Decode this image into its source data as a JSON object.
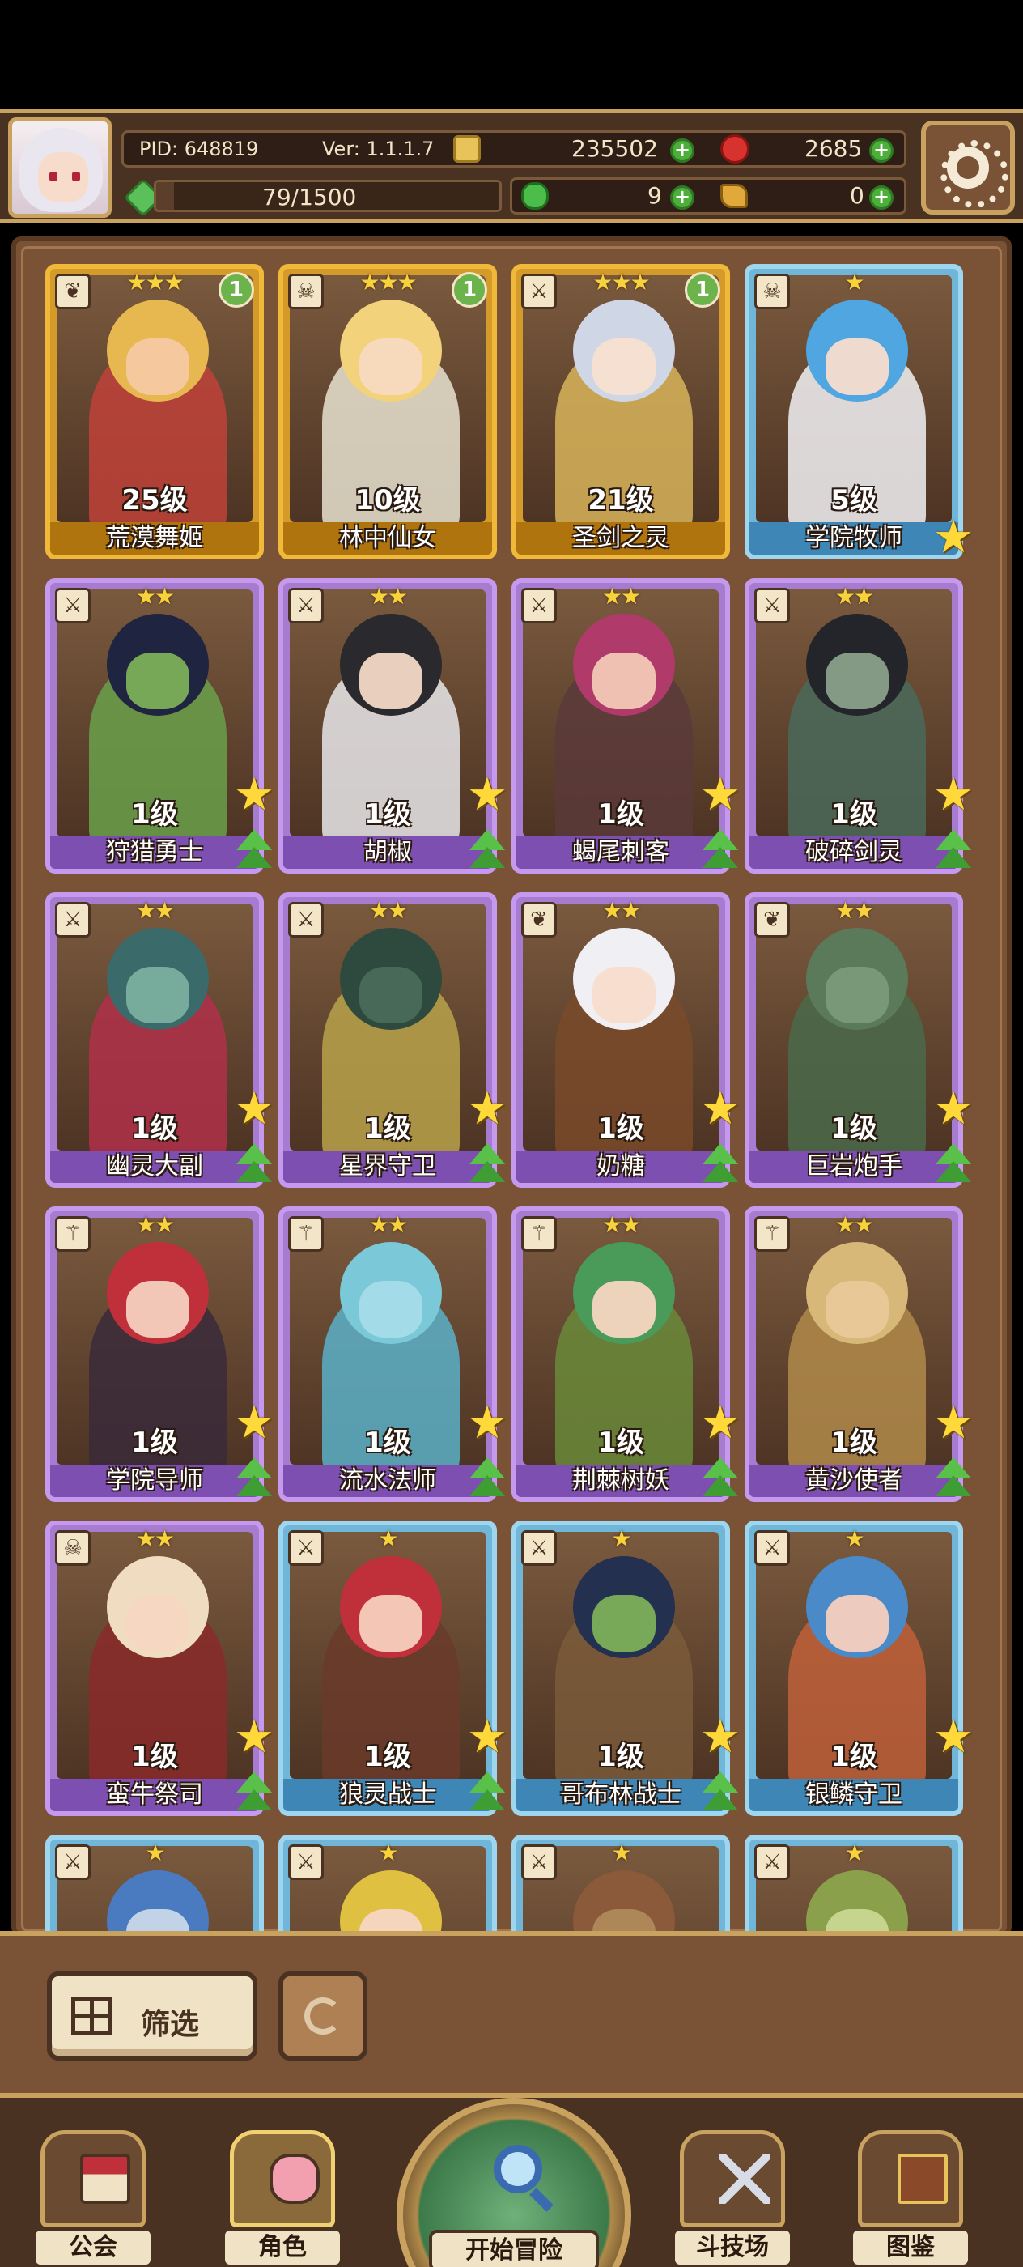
{
  "header": {
    "pid": "PID: 648819",
    "version": "Ver: 1.1.1.7",
    "gold": "235502",
    "rubies": "2685",
    "energy": "79/1500",
    "energy_value": 79,
    "energy_max": 1500,
    "clover": "9",
    "scrolls": "0"
  },
  "heroes": [
    {
      "name": "荒漠舞姬",
      "level": "25级",
      "rarity": "gold",
      "stars": "★★★",
      "badge": "1",
      "class_icon": "leaf",
      "palette": [
        "#e8b850",
        "#c0423a",
        "#f5c8a2"
      ]
    },
    {
      "name": "林中仙女",
      "level": "10级",
      "rarity": "gold",
      "stars": "★★★",
      "badge": "1",
      "class_icon": "skull",
      "palette": [
        "#f2d27a",
        "#e7e3d0",
        "#f7d9c0"
      ]
    },
    {
      "name": "圣剑之灵",
      "level": "21级",
      "rarity": "gold",
      "stars": "★★★",
      "badge": "1",
      "class_icon": "sword",
      "palette": [
        "#cfd6e6",
        "#d8b45a",
        "#f7e0d0"
      ]
    },
    {
      "name": "学院牧师",
      "level": "5级",
      "rarity": "blue",
      "stars": "★",
      "badge": "",
      "class_icon": "skull",
      "palette": [
        "#4fa6e0",
        "#f2f2f4",
        "#f7dccc"
      ]
    },
    {
      "name": "狩猎勇士",
      "level": "1级",
      "rarity": "purple",
      "stars": "★★",
      "badge": "",
      "class_icon": "sword",
      "palette": [
        "#1f2440",
        "#6aa04a",
        "#7cb05a"
      ]
    },
    {
      "name": "胡椒",
      "level": "1级",
      "rarity": "purple",
      "stars": "★★",
      "badge": "",
      "class_icon": "sword",
      "palette": [
        "#2a2a2e",
        "#e8e8ea",
        "#f2d8c6"
      ]
    },
    {
      "name": "蝎尾刺客",
      "level": "1级",
      "rarity": "purple",
      "stars": "★★",
      "badge": "",
      "class_icon": "sword",
      "palette": [
        "#b03a6a",
        "#5a3a3a",
        "#f2c8b6"
      ]
    },
    {
      "name": "破碎剑灵",
      "level": "1级",
      "rarity": "purple",
      "stars": "★★",
      "badge": "",
      "class_icon": "sword",
      "palette": [
        "#24252a",
        "#4a6a5a",
        "#8aa08a"
      ]
    },
    {
      "name": "幽灵大副",
      "level": "1级",
      "rarity": "purple",
      "stars": "★★",
      "badge": "",
      "class_icon": "sword",
      "palette": [
        "#3a6a6a",
        "#b0304a",
        "#7ab0a0"
      ]
    },
    {
      "name": "星界守卫",
      "level": "1级",
      "rarity": "purple",
      "stars": "★★",
      "badge": "",
      "class_icon": "sword",
      "palette": [
        "#2e4a3e",
        "#b8a24a",
        "#4a6a5a"
      ]
    },
    {
      "name": "奶糖",
      "level": "1级",
      "rarity": "purple",
      "stars": "★★",
      "badge": "",
      "class_icon": "leaf",
      "palette": [
        "#f0f0f4",
        "#7a4a2a",
        "#f7dccc"
      ]
    },
    {
      "name": "巨岩炮手",
      "level": "1级",
      "rarity": "purple",
      "stars": "★★",
      "badge": "",
      "class_icon": "leaf",
      "palette": [
        "#5a7a5a",
        "#4a6a4a",
        "#7a9a7a"
      ]
    },
    {
      "name": "学院导师",
      "level": "1级",
      "rarity": "purple",
      "stars": "★★",
      "badge": "",
      "class_icon": "wand",
      "palette": [
        "#c0303a",
        "#3a2a3a",
        "#f5d0bf"
      ]
    },
    {
      "name": "流水法师",
      "level": "1级",
      "rarity": "purple",
      "stars": "★★",
      "badge": "",
      "class_icon": "wand",
      "palette": [
        "#7ac8d8",
        "#5ab0c8",
        "#a6dcea"
      ]
    },
    {
      "name": "荆棘树妖",
      "level": "1级",
      "rarity": "purple",
      "stars": "★★",
      "badge": "",
      "class_icon": "wand",
      "palette": [
        "#4a9a5a",
        "#6a8a3a",
        "#f5d6c2"
      ]
    },
    {
      "name": "黄沙使者",
      "level": "1级",
      "rarity": "purple",
      "stars": "★★",
      "badge": "",
      "class_icon": "wand",
      "palette": [
        "#d8b878",
        "#b08a4a",
        "#e8c898"
      ]
    },
    {
      "name": "蛮牛祭司",
      "level": "1级",
      "rarity": "purple",
      "stars": "★★",
      "badge": "",
      "class_icon": "skull",
      "palette": [
        "#f0dcc0",
        "#8a2a2a",
        "#f5d6c2"
      ]
    },
    {
      "name": "狼灵战士",
      "level": "1级",
      "rarity": "blue",
      "stars": "★",
      "badge": "",
      "class_icon": "sword",
      "palette": [
        "#c0303a",
        "#6a3a2a",
        "#f5cfbd"
      ]
    },
    {
      "name": "哥布林战士",
      "level": "1级",
      "rarity": "blue",
      "stars": "★",
      "badge": "",
      "class_icon": "sword",
      "palette": [
        "#243050",
        "#7a5a3a",
        "#7cb05a"
      ]
    },
    {
      "name": "银鳞守卫",
      "level": "1级",
      "rarity": "blue",
      "stars": "★",
      "badge": "",
      "class_icon": "sword",
      "palette": [
        "#4a8ac8",
        "#c0603a",
        "#f5d0bf"
      ]
    },
    {
      "name": "",
      "level": "",
      "rarity": "blue",
      "stars": "★",
      "badge": "",
      "class_icon": "sword",
      "palette": [
        "#4a7ac0",
        "#8aa0c0",
        "#c8d8ea"
      ]
    },
    {
      "name": "",
      "level": "",
      "rarity": "blue",
      "stars": "★",
      "badge": "",
      "class_icon": "sword",
      "palette": [
        "#e0c040",
        "#2a2a3a",
        "#f5d6c2"
      ]
    },
    {
      "name": "",
      "level": "",
      "rarity": "blue",
      "stars": "★",
      "badge": "",
      "class_icon": "sword",
      "palette": [
        "#8a5a3a",
        "#5a7a4a",
        "#b08a5a"
      ]
    },
    {
      "name": "",
      "level": "",
      "rarity": "blue",
      "stars": "★",
      "badge": "",
      "class_icon": "sword",
      "palette": [
        "#8aa04a",
        "#b07a3a",
        "#c8d890"
      ]
    }
  ],
  "filter": {
    "label": "筛选"
  },
  "nav": {
    "guild": "公会",
    "roles": "角色",
    "adventure": "开始冒险",
    "arena": "斗技场",
    "codex": "图鉴"
  }
}
